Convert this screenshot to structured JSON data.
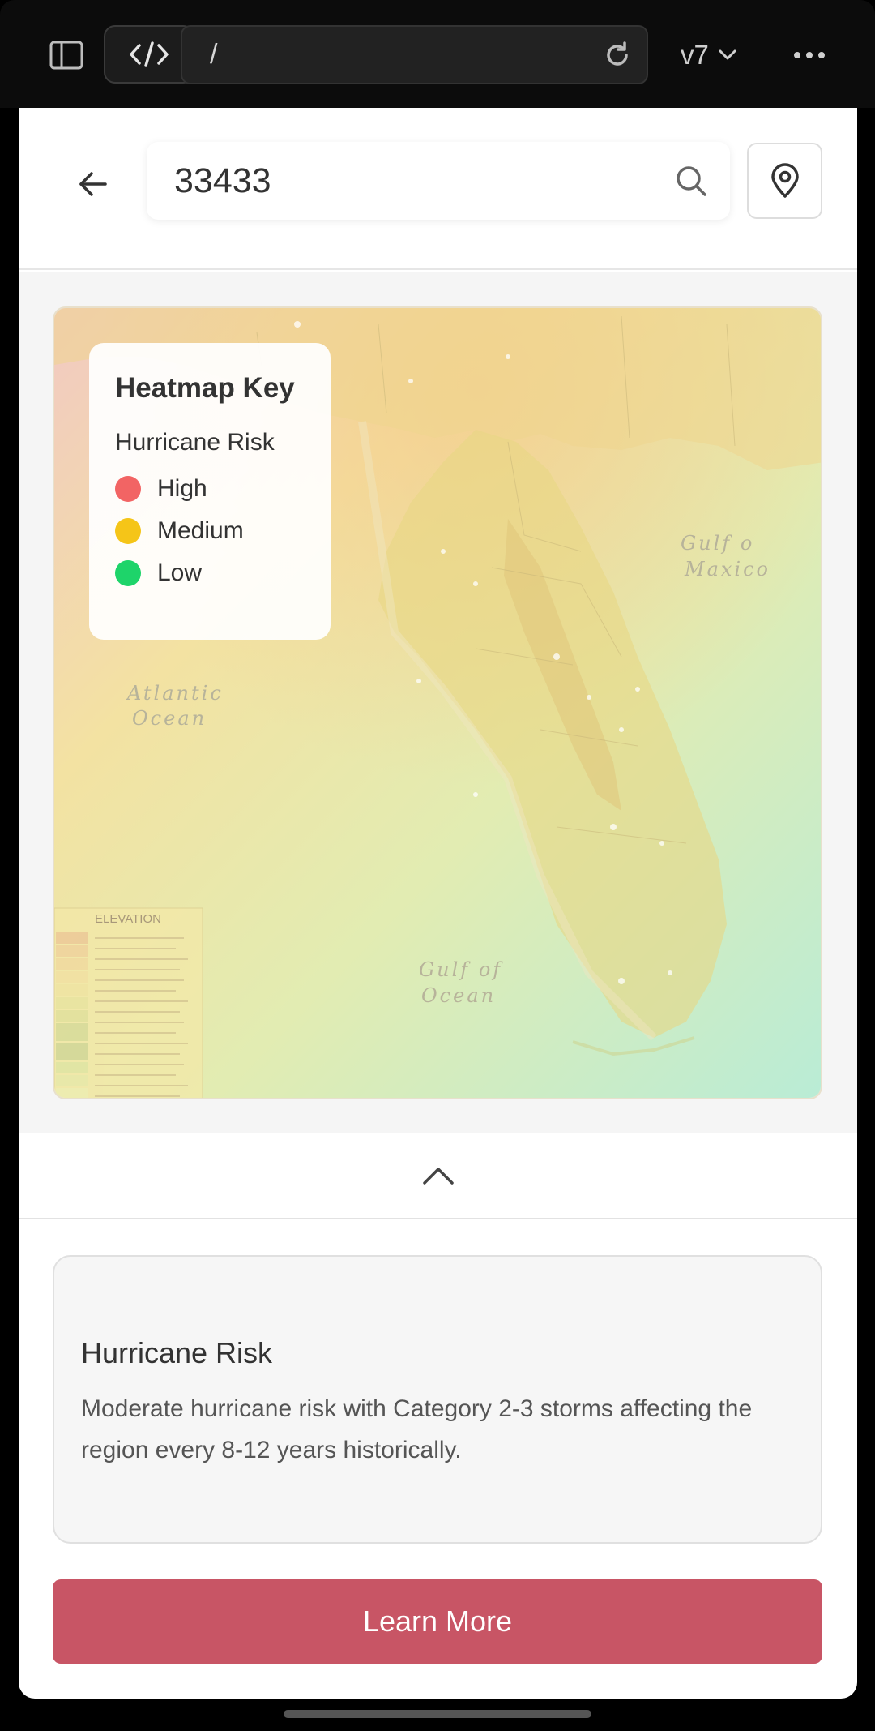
{
  "browser": {
    "url": "/",
    "version": "v7"
  },
  "search": {
    "value": "33433"
  },
  "map": {
    "labels": {
      "gulf_mexico_1": "Gulf o",
      "gulf_mexico_2": "Maxico",
      "atlantic_1": "Atlantic",
      "atlantic_2": "Ocean",
      "gulf_ocean_1": "Gulf of",
      "gulf_ocean_2": "Ocean",
      "elevation": "ELEVATION"
    }
  },
  "legend": {
    "title": "Heatmap Key",
    "subtitle": "Hurricane Risk",
    "items": [
      {
        "label": "High",
        "color": "#f26464"
      },
      {
        "label": "Medium",
        "color": "#f5c518"
      },
      {
        "label": "Low",
        "color": "#1ed46a"
      }
    ]
  },
  "info": {
    "title": "Hurricane Risk",
    "description": "Moderate hurricane risk with Category 2-3 storms affecting the region every 8-12 years historically."
  },
  "cta": {
    "label": "Learn More",
    "color": "#c85565"
  }
}
